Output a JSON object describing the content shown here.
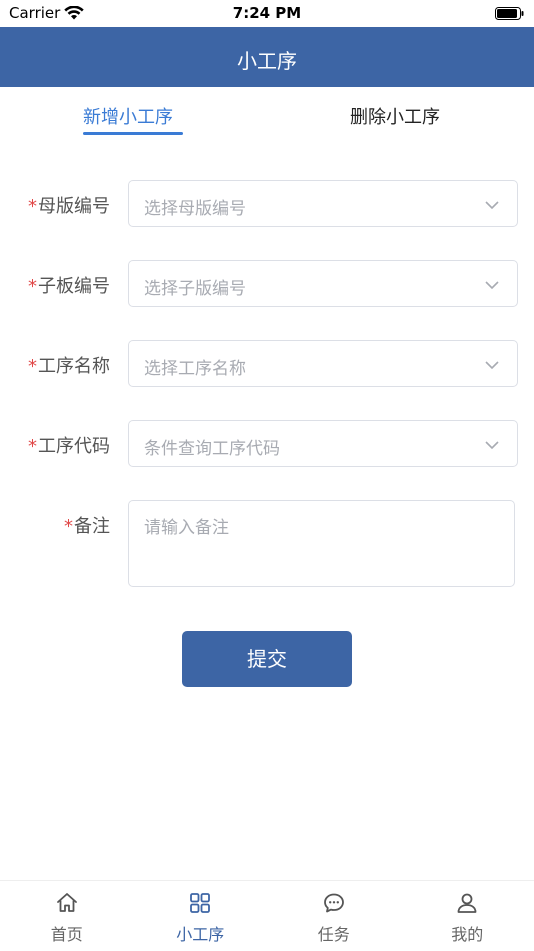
{
  "status_bar": {
    "carrier": "Carrier",
    "time": "7:24 PM"
  },
  "header": {
    "title": "小工序"
  },
  "tabs": [
    {
      "label": "新增小工序",
      "active": true
    },
    {
      "label": "删除小工序",
      "active": false
    }
  ],
  "form": {
    "required_mark": "*",
    "fields": [
      {
        "label": "母版编号",
        "placeholder": "选择母版编号",
        "type": "select",
        "required": true
      },
      {
        "label": "子板编号",
        "placeholder": "选择子版编号",
        "type": "select",
        "required": true
      },
      {
        "label": "工序名称",
        "placeholder": "选择工序名称",
        "type": "select",
        "required": true
      },
      {
        "label": "工序代码",
        "placeholder": "条件查询工序代码",
        "type": "select",
        "required": true
      },
      {
        "label": "备注",
        "placeholder": "请输入备注",
        "type": "textarea",
        "required": true
      }
    ],
    "submit_label": "提交"
  },
  "bottom_nav": [
    {
      "label": "首页",
      "icon": "home-icon",
      "active": false
    },
    {
      "label": "小工序",
      "icon": "grid-icon",
      "active": true
    },
    {
      "label": "任务",
      "icon": "chat-icon",
      "active": false
    },
    {
      "label": "我的",
      "icon": "user-icon",
      "active": false
    }
  ],
  "colors": {
    "primary": "#3d65a5",
    "tab_active": "#3a7bd5",
    "required": "#e04848",
    "placeholder": "#a8abb2",
    "border": "#dcdfe6"
  }
}
